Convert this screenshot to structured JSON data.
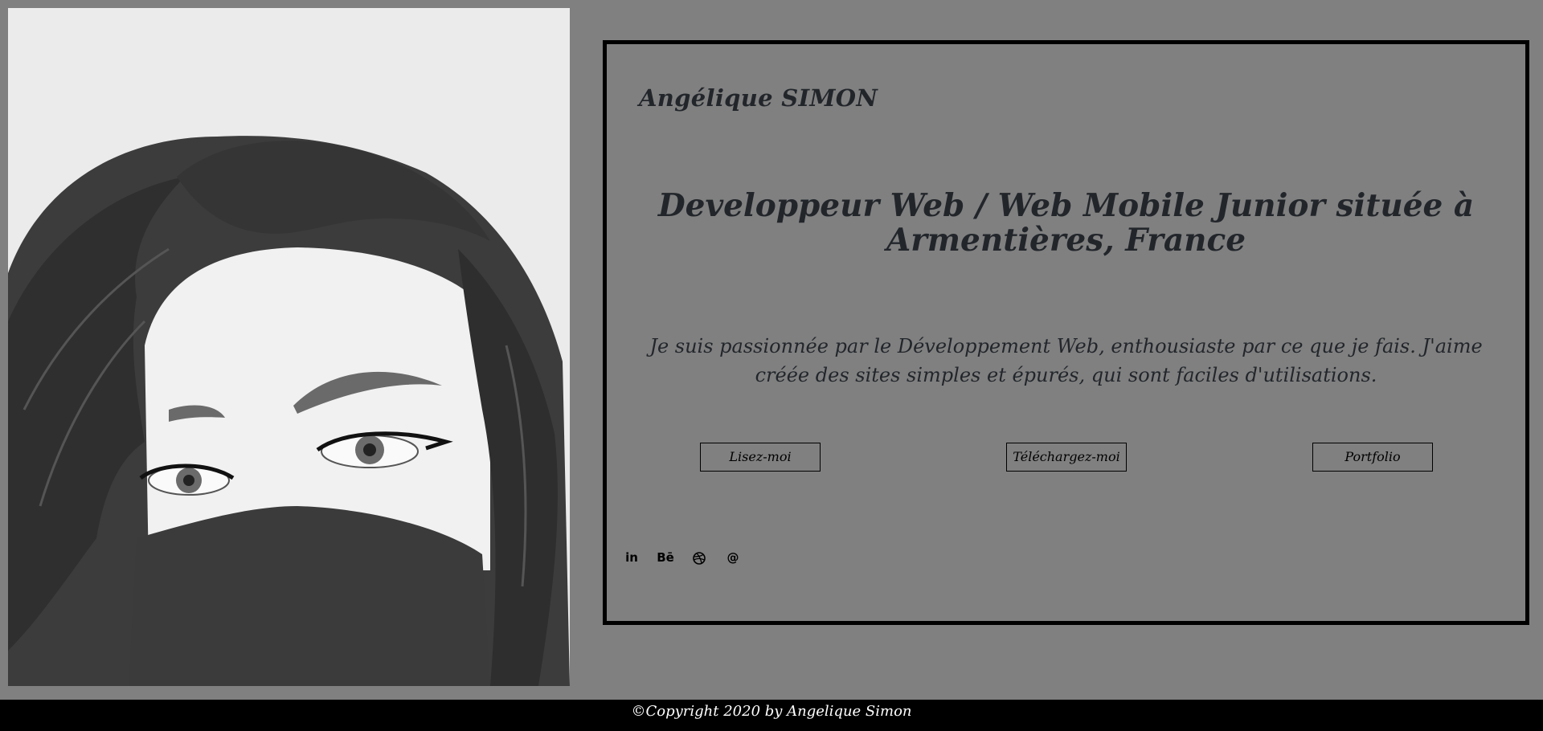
{
  "portrait": {
    "alt": "Illustration of a woman with long dark hair wearing a black face mask"
  },
  "card": {
    "brand": "Angélique SIMON",
    "headline": "Developpeur Web / Web Mobile Junior située à Armentières, France",
    "intro": "Je suis passionnée par le Développement Web, enthousiaste par ce que je fais. J'aime créée des sites simples et épurés, qui sont faciles d'utilisations.",
    "buttons": {
      "readme": "Lisez-moi",
      "download": "Téléchargez-moi",
      "portfolio": "Portfolio"
    },
    "social": {
      "linkedin": "in",
      "behance": "Bē",
      "dribbble_icon": "dribbble-icon",
      "email": "@"
    }
  },
  "footer": {
    "copyright": "©Copyright 2020 by Angelique Simon"
  },
  "colors": {
    "background": "#808080",
    "border": "#000000",
    "text": "#22262b",
    "footer_bg": "#000000",
    "footer_text": "#ffffff"
  }
}
